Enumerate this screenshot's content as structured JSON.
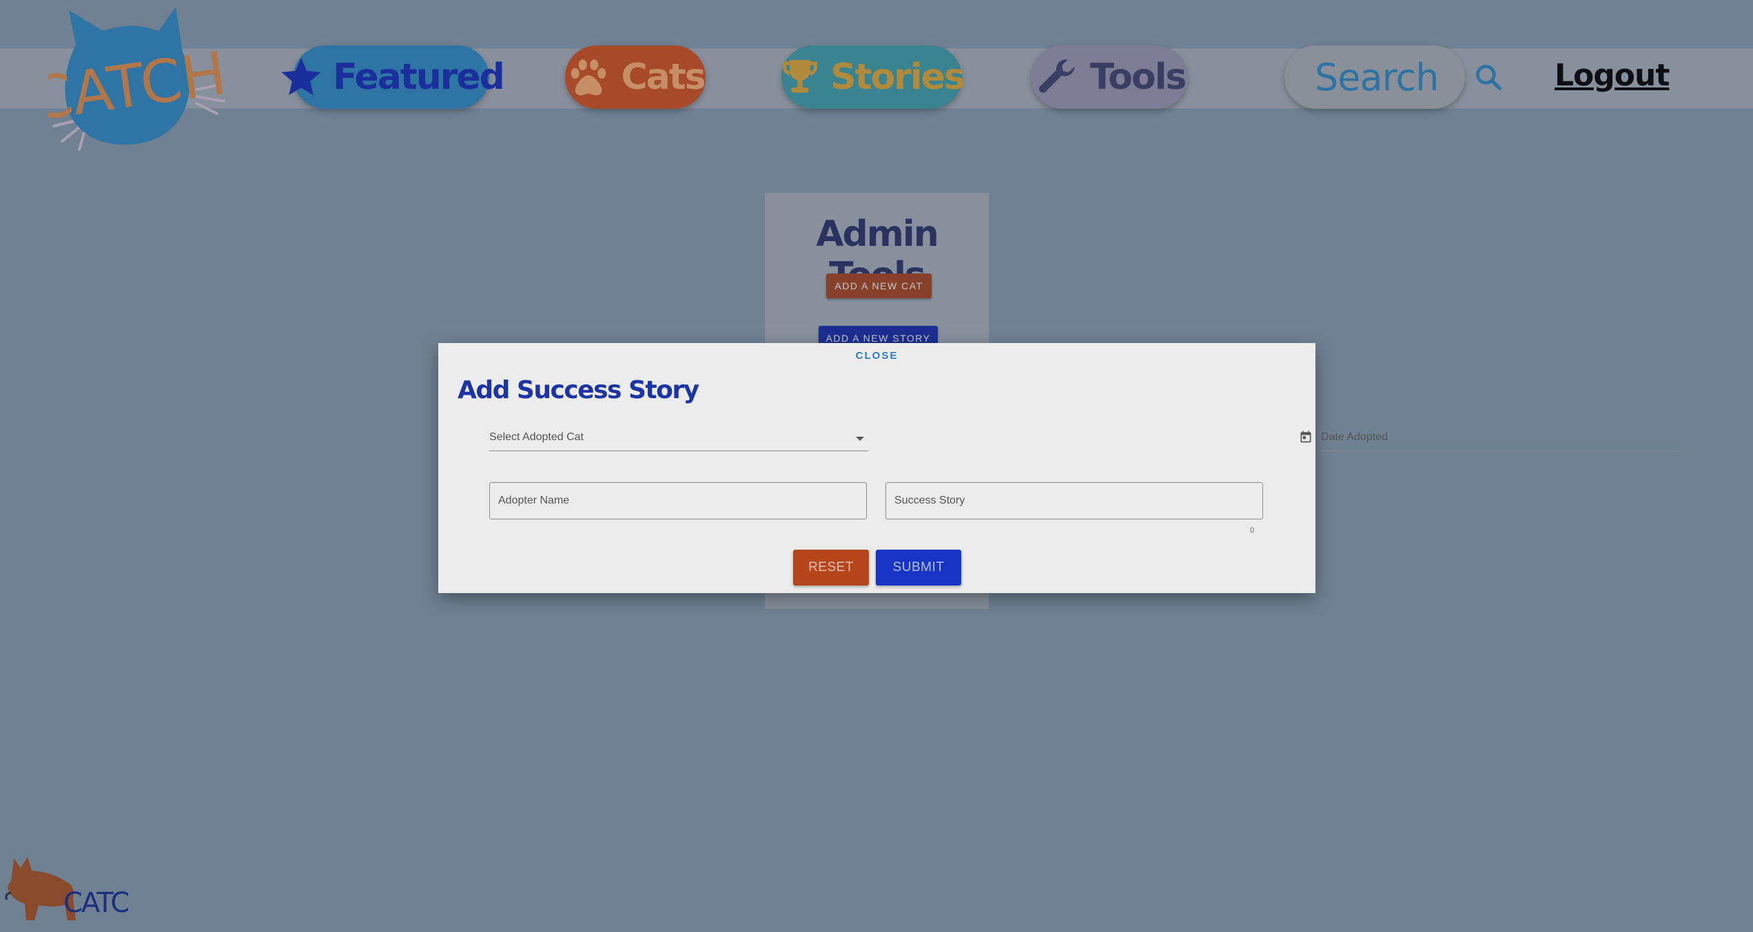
{
  "nav": {
    "logo_text": "CATCH",
    "featured_label": "Featured",
    "cats_label": "Cats",
    "stories_label": "Stories",
    "tools_label": "Tools",
    "search_label": "Search",
    "logout_label": "Logout"
  },
  "admin": {
    "title": "Admin Tools",
    "add_cat_label": "ADD A NEW CAT",
    "add_story_label": "ADD A NEW STORY"
  },
  "dialog": {
    "close_label": "CLOSE",
    "title": "Add Success Story",
    "select_cat_placeholder": "Select Adopted Cat",
    "date_placeholder": "Date Adopted",
    "adopter_placeholder": "Adopter Name",
    "story_placeholder": "Success Story",
    "char_count": "0",
    "reset_label": "RESET",
    "submit_label": "SUBMIT"
  },
  "footer": {
    "logo_text": "CATCH"
  },
  "colors": {
    "background": "#6f8192",
    "accent_blue": "#1834c6",
    "accent_orange": "#b6451c",
    "link_blue": "#2f7bbf"
  },
  "icons": [
    "cat-logo-icon",
    "star-icon",
    "paw-icon",
    "trophy-icon",
    "wrench-icon",
    "search-icon",
    "calendar-icon",
    "dropdown-caret-icon"
  ]
}
